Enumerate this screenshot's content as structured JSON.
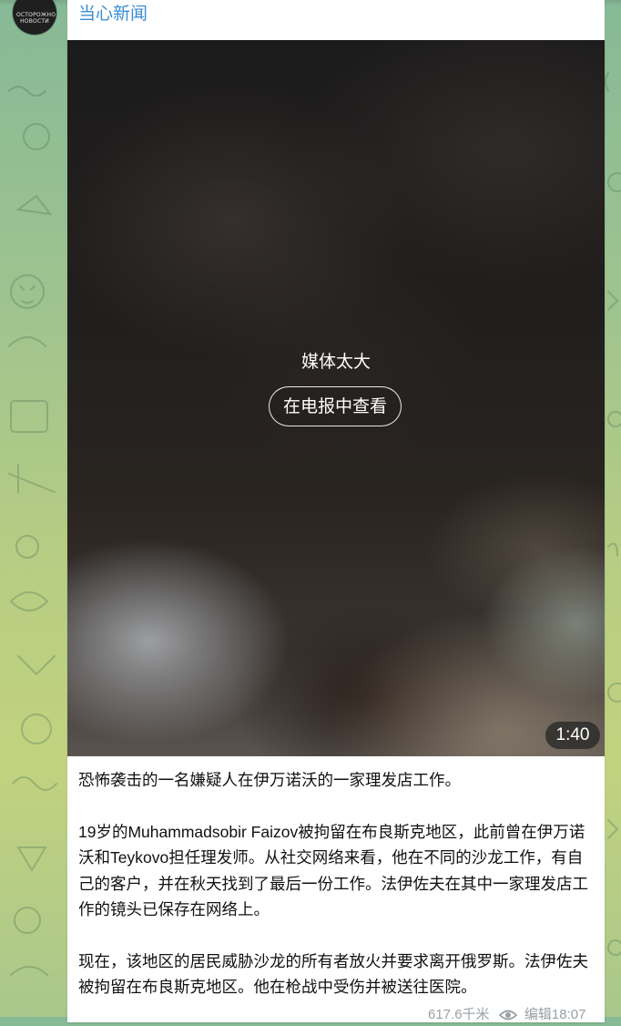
{
  "channel": {
    "avatar_text": "ОСТОРОЖНО НОВОСТИ",
    "name": "当心新闻"
  },
  "media": {
    "label": "媒体太大",
    "view_button": "在电报中查看",
    "duration": "1:40"
  },
  "post": {
    "paragraphs": [
      "恐怖袭击的一名嫌疑人在伊万诺沃的一家理发店工作。",
      "19岁的Muhammadsobir Faizov被拘留在布良斯克地区，此前曾在伊万诺沃和Teykovo担任理发师。从社交网络来看，他在不同的沙龙工作，有自己的客户，并在秋天找到了最后一份工作。法伊佐夫在其中一家理发店工作的镜头已保存在网络上。",
      "现在，该地区的居民威胁沙龙的所有者放火并要求离开俄罗斯。法伊佐夫被拘留在布良斯克地区。他在枪战中受伤并被送往医院。"
    ],
    "views": "617.6千米",
    "edited": "编辑18:07"
  },
  "colors": {
    "link": "#3a8ed4",
    "text": "#111111",
    "meta": "#9aa0a6"
  },
  "icons": {
    "views": "eye-icon"
  }
}
